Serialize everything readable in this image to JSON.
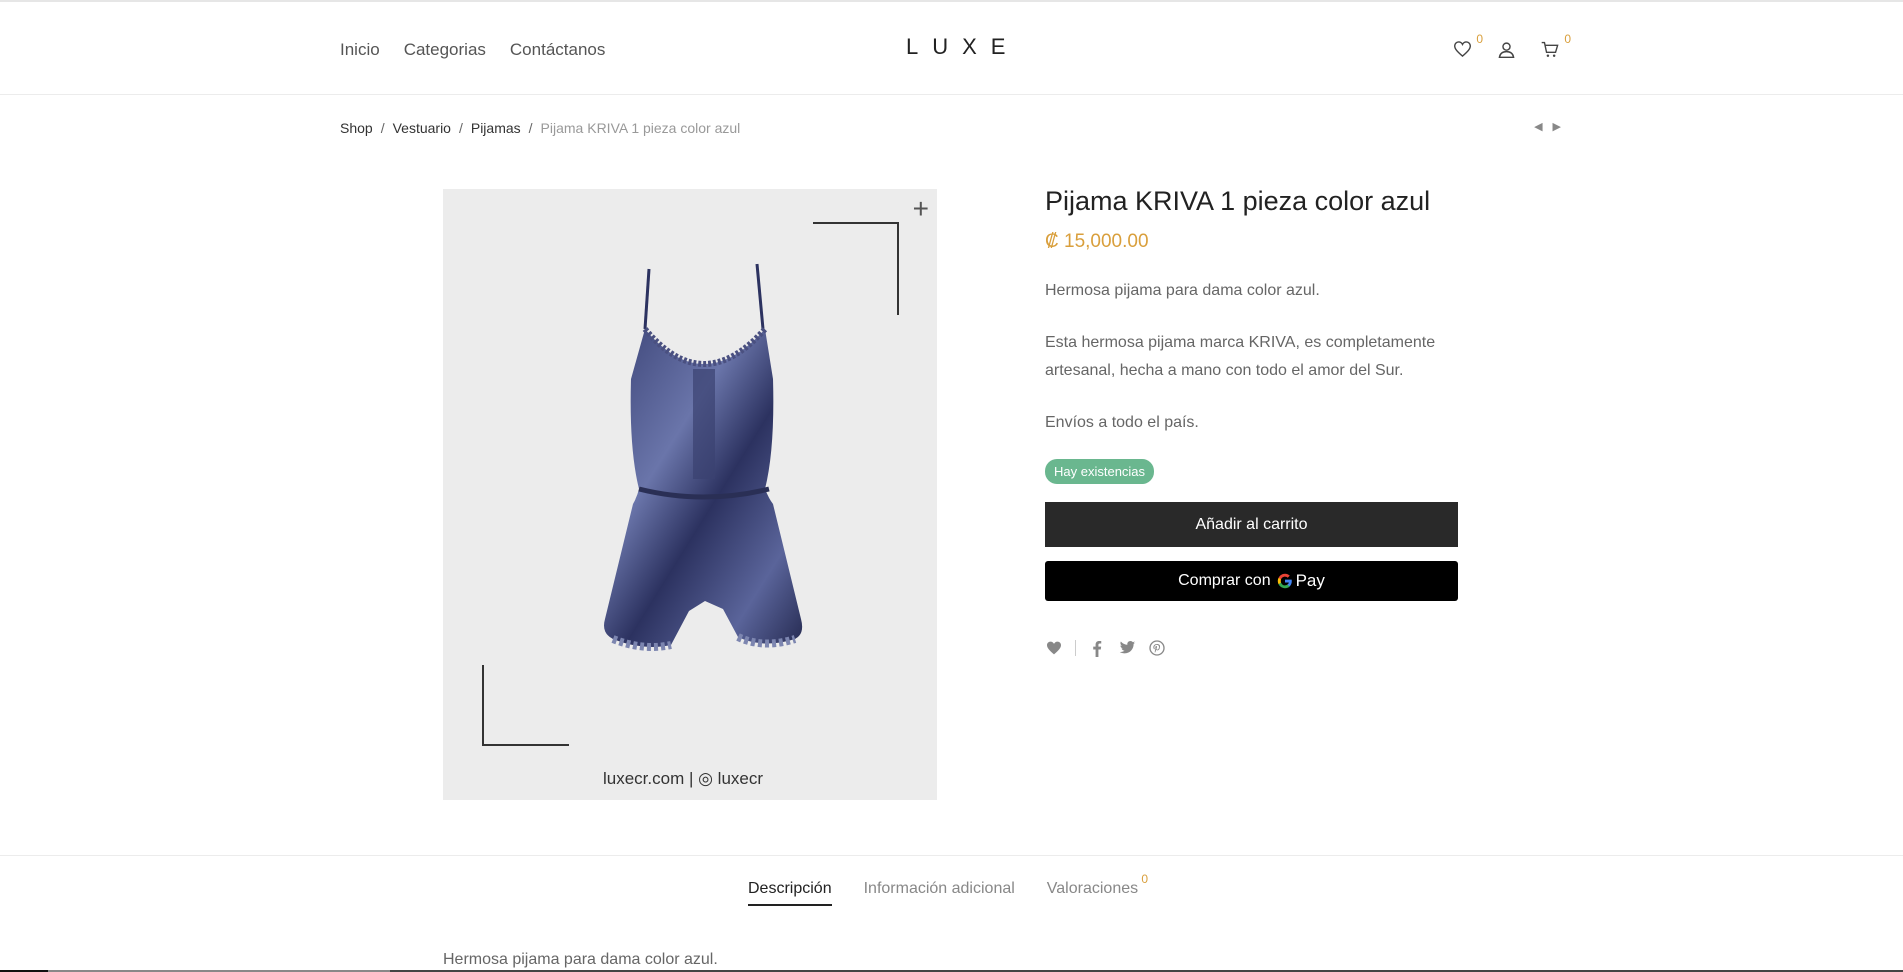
{
  "header": {
    "nav": [
      "Inicio",
      "Categorias",
      "Contáctanos"
    ],
    "logo": "LUXE",
    "wishlist_count": "0",
    "cart_count": "0"
  },
  "breadcrumb": {
    "items": [
      "Shop",
      "Vestuario",
      "Pijamas"
    ],
    "current": "Pijama KRIVA 1 pieza color azul",
    "separator": "/"
  },
  "product": {
    "title": "Pijama KRIVA 1 pieza color azul",
    "price": "₡ 15,000.00",
    "description": [
      "Hermosa pijama para dama color azul.",
      "Esta hermosa pijama marca KRIVA, es completamente artesanal, hecha a mano con todo el amor del Sur.",
      "Envíos a todo el país."
    ],
    "stock": "Hay existencias",
    "add_to_cart": "Añadir al carrito",
    "gpay_label": "Comprar con",
    "gpay_brand": "Pay",
    "image_watermark": "luxecr.com  | ◎ luxecr"
  },
  "tabs": {
    "items": [
      "Descripción",
      "Información adicional",
      "Valoraciones"
    ],
    "reviews_count": "0",
    "content": "Hermosa pijama para dama color azul."
  },
  "colors": {
    "accent": "#d99f3c",
    "stock_badge": "#6ab78f",
    "button_dark": "#292929"
  }
}
